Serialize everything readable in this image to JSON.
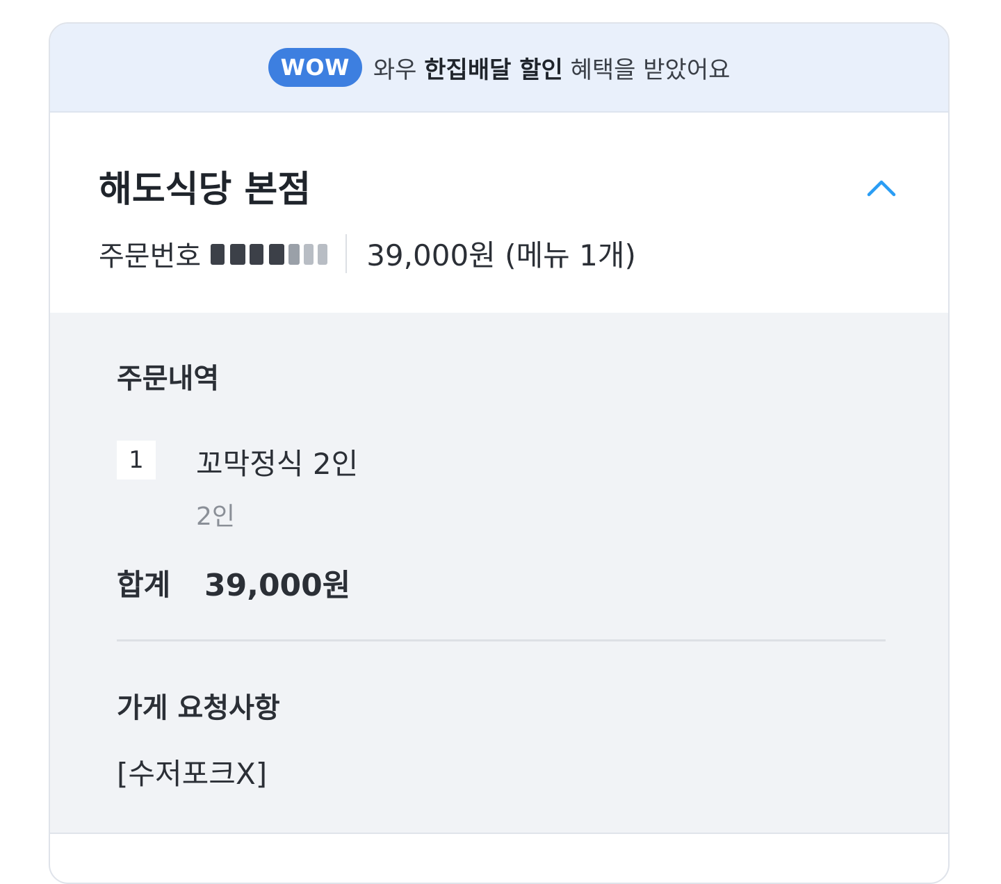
{
  "banner": {
    "badge": "WOW",
    "text_prefix": "와우",
    "text_strong": "한집배달 할인",
    "text_suffix": "혜택을 받았어요"
  },
  "order": {
    "store_name": "해도식당 본점",
    "number_label": "주문번호",
    "summary": "39,000원 (메뉴 1개)"
  },
  "details": {
    "section_title": "주문내역",
    "items": [
      {
        "qty": "1",
        "name": "꼬막정식 2인",
        "option": "2인"
      }
    ],
    "total_label": "합계",
    "total_value": "39,000원"
  },
  "request": {
    "title": "가게 요청사항",
    "text": "[수저포크X]"
  },
  "colors": {
    "accent": "#3d7fe0",
    "chevron": "#2a9df4",
    "banner_bg": "#e9f0fb",
    "body_bg": "#f1f3f6"
  }
}
